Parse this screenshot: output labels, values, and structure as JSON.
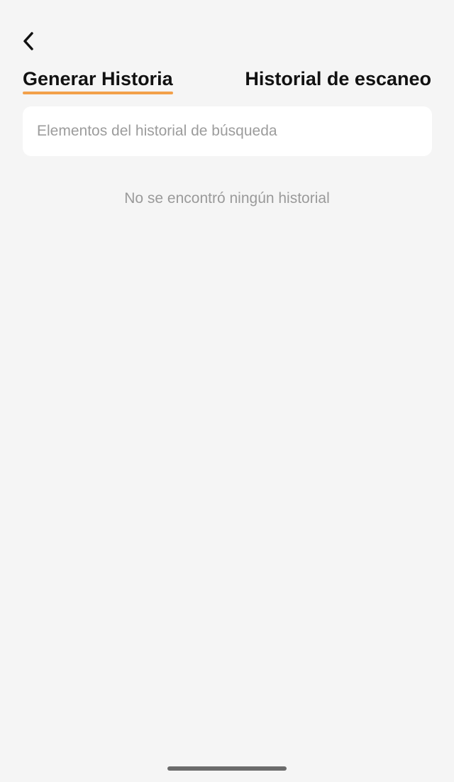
{
  "header": {
    "back_icon": "chevron-left-icon"
  },
  "tabs": [
    {
      "label": "Generar Historia",
      "active": true
    },
    {
      "label": "Historial de escaneo",
      "active": false
    }
  ],
  "search": {
    "placeholder": "Elementos del historial de búsqueda",
    "value": ""
  },
  "empty_state": {
    "message": "No se encontró ningún historial"
  },
  "colors": {
    "background": "#f5f5f5",
    "accent": "#f2a04a",
    "text_primary": "#111111",
    "text_muted": "#9a9a9a"
  }
}
